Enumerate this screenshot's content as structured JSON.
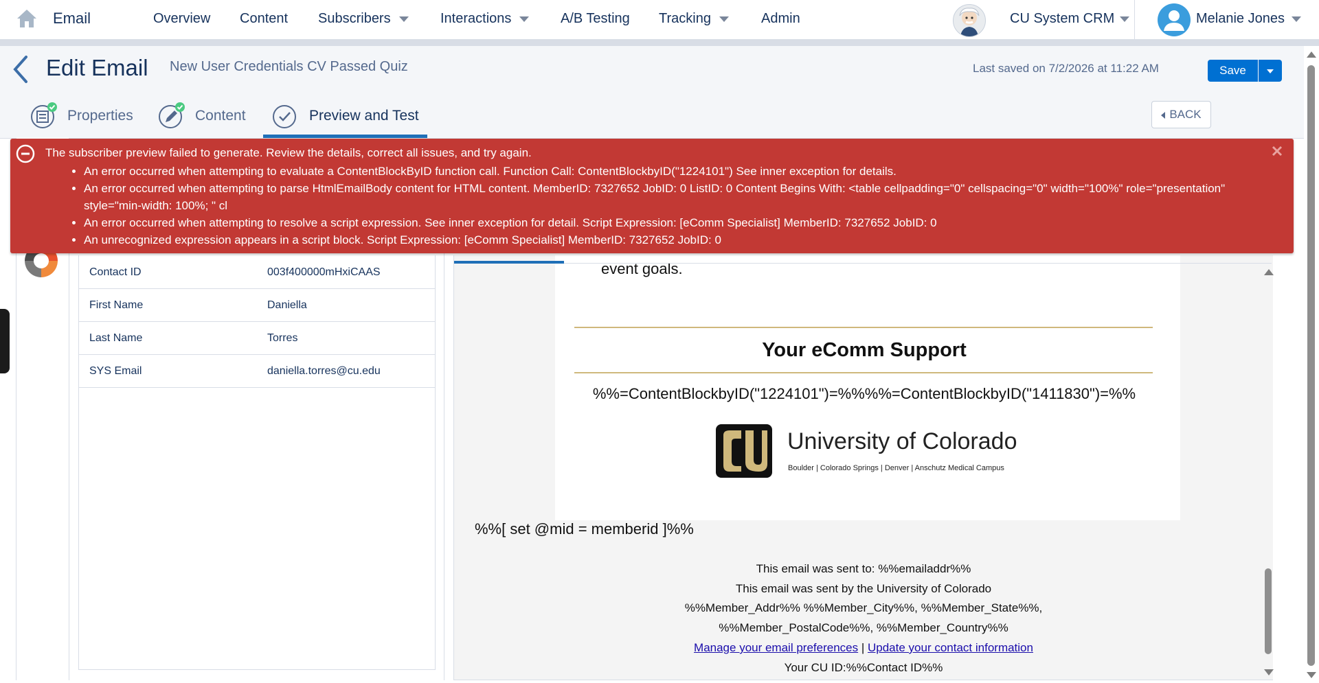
{
  "topnav": {
    "app_name": "Email",
    "items": [
      {
        "label": "Overview",
        "has_dropdown": false
      },
      {
        "label": "Content",
        "has_dropdown": false
      },
      {
        "label": "Subscribers",
        "has_dropdown": true
      },
      {
        "label": "Interactions",
        "has_dropdown": true
      },
      {
        "label": "A/B Testing",
        "has_dropdown": false
      },
      {
        "label": "Tracking",
        "has_dropdown": true
      },
      {
        "label": "Admin",
        "has_dropdown": false
      }
    ],
    "business_unit": "CU System CRM",
    "user_name": "Melanie Jones",
    "icons": {
      "home": "home-icon",
      "account": "einstein-avatar-icon",
      "user": "user-avatar-icon"
    }
  },
  "header": {
    "title": "Edit Email",
    "email_name": "New User Credentials CV Passed Quiz",
    "last_saved": "Last saved on 7/2/2026 at 11:22 AM",
    "save_label": "Save",
    "back_label": "BACK"
  },
  "tabs": [
    {
      "label": "Properties",
      "complete": true
    },
    {
      "label": "Content",
      "complete": true
    },
    {
      "label": "Preview and Test",
      "active": true
    }
  ],
  "error": {
    "summary": "The subscriber preview failed to generate. Review the details, correct all issues, and try again.",
    "details": [
      "An error occurred when attempting to evaluate a ContentBlockByID function call. Function Call: ContentBlockbyID(\"1224101\") See inner exception for details.",
      "An error occurred when attempting to parse HtmlEmailBody content for HTML content. MemberID: 7327652 JobID: 0 ListID: 0 Content Begins With: <table cellpadding=\"0\" cellspacing=\"0\" width=\"100%\" role=\"presentation\" style=\"min-width: 100%; \" cl",
      "An error occurred when attempting to resolve a script expression. See inner exception for detail. Script Expression: [eComm Specialist] MemberID: 7327652 JobID: 0",
      "An unrecognized expression appears in a script block. Script Expression: [eComm Specialist] MemberID: 7327652 JobID: 0"
    ]
  },
  "subscriber": {
    "fields": [
      {
        "name": "Contact ID",
        "value": "003f400000mHxiCAAS"
      },
      {
        "name": "First Name",
        "value": "Daniella"
      },
      {
        "name": "Last Name",
        "value": "Torres"
      },
      {
        "name": "SYS Email",
        "value": "daniella.torres@cu.edu"
      }
    ]
  },
  "preview": {
    "event_goals": "event goals.",
    "support_heading": "Your eComm Support",
    "content_block_expr": "%%=ContentBlockbyID(\"1224101\")=%%%%=ContentBlockbyID(\"1411830\")=%%",
    "logo": {
      "name": "University of Colorado",
      "campuses": "Boulder | Colorado Springs | Denver | Anschutz Medical Campus"
    },
    "set_expr": "%%[ set @mid = memberid ]%%",
    "footer": {
      "sent_to": "This email was sent to: %%emailaddr%%",
      "sent_by": "This email was sent by the University of Colorado",
      "address_1": "%%Member_Addr%% %%Member_City%%, %%Member_State%%,",
      "address_2": "%%Member_PostalCode%%, %%Member_Country%%",
      "manage_prefs": "Manage your email preferences",
      "separator": "|",
      "update_contact": "Update your contact information",
      "cu_id": "Your CU ID:%%Contact ID%%"
    }
  },
  "colors": {
    "brand_blue": "#0070d2",
    "error_red": "#c23934",
    "cu_gold": "#cfb87c",
    "text_navy": "#16325c",
    "link_blue": "#1a0dab"
  }
}
